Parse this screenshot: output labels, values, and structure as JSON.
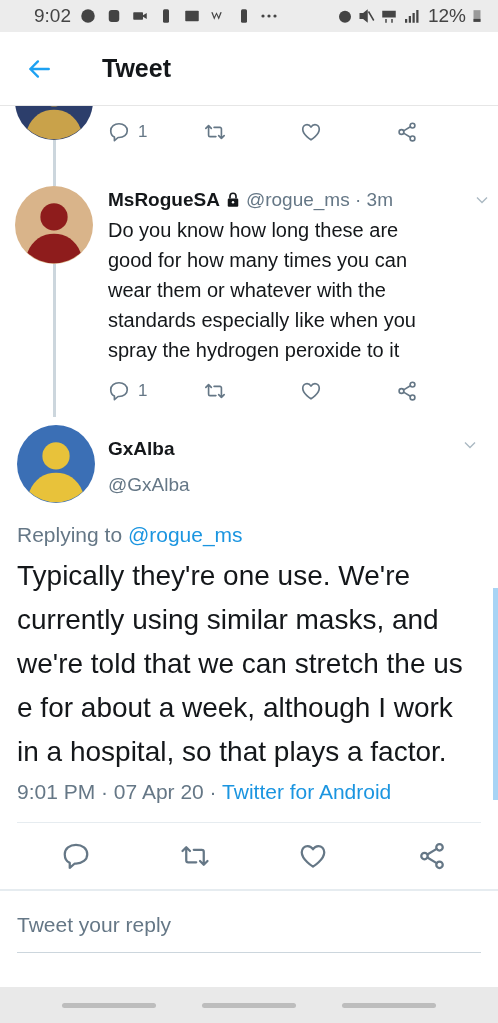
{
  "status_bar": {
    "time": "9:02",
    "battery": "12%"
  },
  "header": {
    "title": "Tweet"
  },
  "thread": [
    {
      "kind": "stub",
      "reply_count": "1"
    },
    {
      "kind": "reply",
      "name": "MsRogueSA",
      "protected": true,
      "handle": "@rogue_ms",
      "separator": "·",
      "time": "3m",
      "text": "Do you know how long these are good for how many times you can wear them or whatever with the standards especially like when you spray the hydrogen peroxide to it",
      "reply_count": "1"
    }
  ],
  "main_tweet": {
    "name": "GxAlba",
    "handle": "@GxAlba",
    "replying_label": "Replying to",
    "replying_to": "@rogue_ms",
    "text": "Typically they're one use. We're currently using similar masks, and we're told that we can stretch the us e for about a week, although I work in a hospital, so that plays a factor.",
    "timestamp": "9:01 PM · 07 Apr 20 ·",
    "source": "Twitter for Android"
  },
  "reply_box": {
    "placeholder": "Tweet your reply"
  }
}
